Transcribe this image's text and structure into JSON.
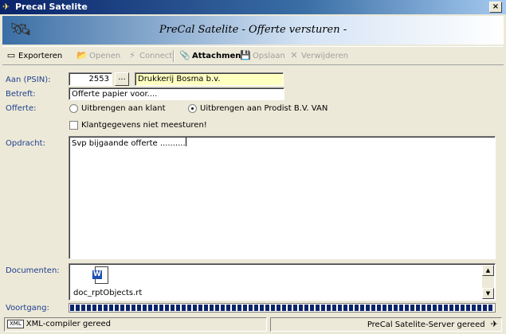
{
  "window": {
    "title": "Precal Satelite",
    "app_icon": "satellite-icon",
    "close_label": "×"
  },
  "banner": {
    "icon": "satellite-dish-icon",
    "title": "PreCal Satelite - Offerte versturen -"
  },
  "toolbar": {
    "exporteren": "Exporteren",
    "openen": "Openen",
    "connect": "Connect",
    "attachment": "Attachment",
    "opslaan": "Opslaan",
    "verwijderen": "Verwijderen"
  },
  "form": {
    "aan_label": "Aan (PSIN):",
    "psin_value": "2553",
    "lookup_label": "...",
    "company_name": "Drukkerij Bosma b.v.",
    "betreft_label": "Betreft:",
    "betreft_value": "Offerte papier voor....",
    "offerte_label": "Offerte:",
    "radio_klant": "Uitbrengen aan klant",
    "radio_prodist": "Uitbrengen aan Prodist B.V. VAN",
    "selected_radio": "prodist",
    "checkbox_label": "Klantgegevens niet meesturen!",
    "checkbox_checked": false,
    "opdracht_label": "Opdracht:",
    "opdracht_value": "Svp bijgaande offerte ..........",
    "documenten_label": "Documenten:",
    "document_name": "doc_rptObjects.rt",
    "document_icon": "word-document-icon",
    "voortgang_label": "Voortgang:",
    "progress": 1.0
  },
  "statusbar": {
    "left_icon": "xml-icon",
    "left_text": "XML-compiler gereed",
    "right_text": "PreCal Satelite-Server gereed",
    "right_icon": "satellite-icon"
  },
  "colors": {
    "label": "#1f3f8f",
    "company_bg": "#ffffc0",
    "progress": "#0a246a",
    "title_bar": "#0a246a"
  }
}
